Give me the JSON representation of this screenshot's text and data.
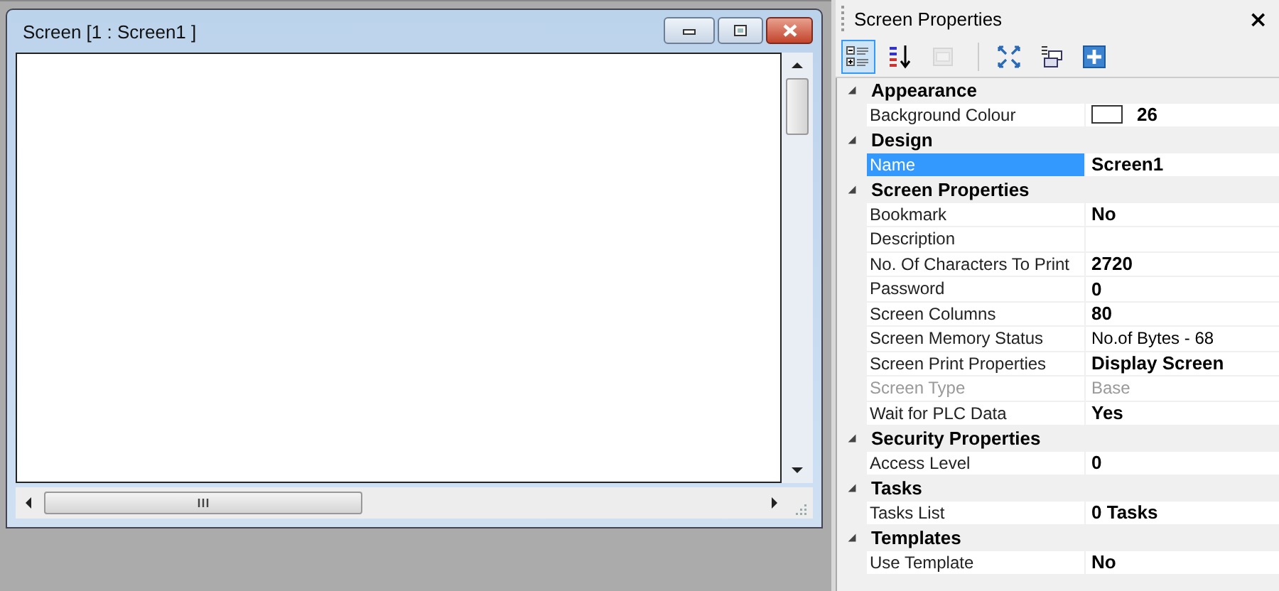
{
  "child_window": {
    "title": "Screen [1 : Screen1 ]",
    "buttons": [
      {
        "kind": "minimize"
      },
      {
        "kind": "restore"
      },
      {
        "kind": "close"
      }
    ]
  },
  "properties_panel": {
    "title": "Screen Properties",
    "close": "×",
    "toolbar": [
      {
        "kind": "categorized",
        "selected": true,
        "disabled": false
      },
      {
        "kind": "alphabetical",
        "selected": false,
        "disabled": false
      },
      {
        "kind": "pages",
        "selected": false,
        "disabled": true
      },
      {
        "kind": "expand",
        "selected": false,
        "disabled": false
      },
      {
        "kind": "collapse",
        "selected": false,
        "disabled": false
      },
      {
        "kind": "add",
        "selected": false,
        "disabled": false
      }
    ],
    "categories": [
      {
        "name": "Appearance",
        "expanded": true,
        "properties": [
          {
            "name": "Background Colour",
            "value": "26",
            "modified": true,
            "selected": false,
            "disabled": false,
            "kind": "colour"
          }
        ]
      },
      {
        "name": "Design",
        "expanded": true,
        "properties": [
          {
            "name": "Name",
            "value": "Screen1",
            "modified": true,
            "selected": true,
            "disabled": false
          }
        ]
      },
      {
        "name": "Screen Properties",
        "expanded": true,
        "properties": [
          {
            "name": "Bookmark",
            "value": "No",
            "modified": true,
            "selected": false,
            "disabled": false
          },
          {
            "name": "Description",
            "selected": false,
            "disabled": false
          },
          {
            "name": "No. Of Characters To Print",
            "value": "2720",
            "modified": true,
            "selected": false,
            "disabled": false
          },
          {
            "name": "Password",
            "value": "0",
            "modified": true,
            "selected": false,
            "disabled": false
          },
          {
            "name": "Screen Columns",
            "value": "80",
            "modified": true,
            "selected": false,
            "disabled": false
          },
          {
            "name": "Screen Memory Status",
            "value": "No.of Bytes - 68",
            "modified": false,
            "selected": false,
            "disabled": false
          },
          {
            "name": "Screen Print Properties",
            "value": "Display Screen",
            "modified": true,
            "selected": false,
            "disabled": false
          },
          {
            "name": "Screen Type",
            "value": "Base",
            "modified": false,
            "selected": false,
            "disabled": true
          },
          {
            "name": "Wait for PLC Data",
            "value": "Yes",
            "modified": true,
            "selected": false,
            "disabled": false
          }
        ]
      },
      {
        "name": "Security Properties",
        "expanded": true,
        "properties": [
          {
            "name": "Access Level",
            "value": "0",
            "modified": true,
            "selected": false,
            "disabled": false
          }
        ]
      },
      {
        "name": "Tasks",
        "expanded": true,
        "properties": [
          {
            "name": "Tasks List",
            "value": "0 Tasks",
            "modified": true,
            "selected": false,
            "disabled": false
          }
        ]
      },
      {
        "name": "Templates",
        "expanded": true,
        "properties": [
          {
            "name": " Use Template",
            "value": "No",
            "modified": true,
            "selected": false,
            "disabled": false
          }
        ]
      }
    ]
  }
}
